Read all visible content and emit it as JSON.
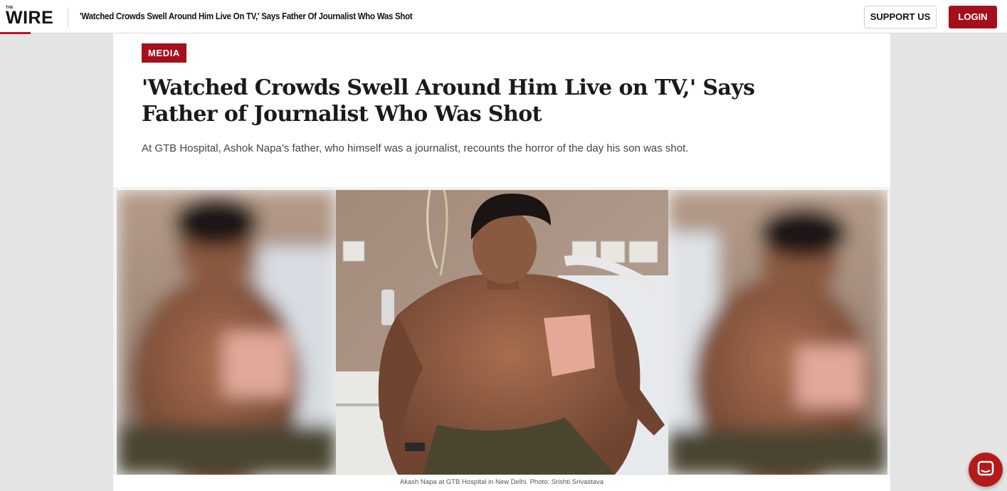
{
  "header": {
    "logo_small": "THE",
    "logo_text": "WIRE",
    "article_title": "'Watched Crowds Swell Around Him Live On TV,' Says Father Of Journalist Who Was Shot",
    "support_label": "SUPPORT US",
    "login_label": "LOGIN"
  },
  "article": {
    "category": "MEDIA",
    "headline": "'Watched Crowds Swell Around Him Live on TV,' Says Father of Journalist Who Was Shot",
    "standfirst": "At GTB Hospital, Ashok Napa’s father, who himself was a journalist, recounts the horror of the day his son was shot.",
    "image_caption": "Akash Napa at GTB Hospital in New Delhi. Photo: Srishti Srivastava"
  },
  "icons": {
    "chat": "chat-bubble-icon"
  },
  "colors": {
    "brand_red": "#a50f1c",
    "logo_accent": "#c8102e",
    "chat_button": "#b51a1a"
  }
}
